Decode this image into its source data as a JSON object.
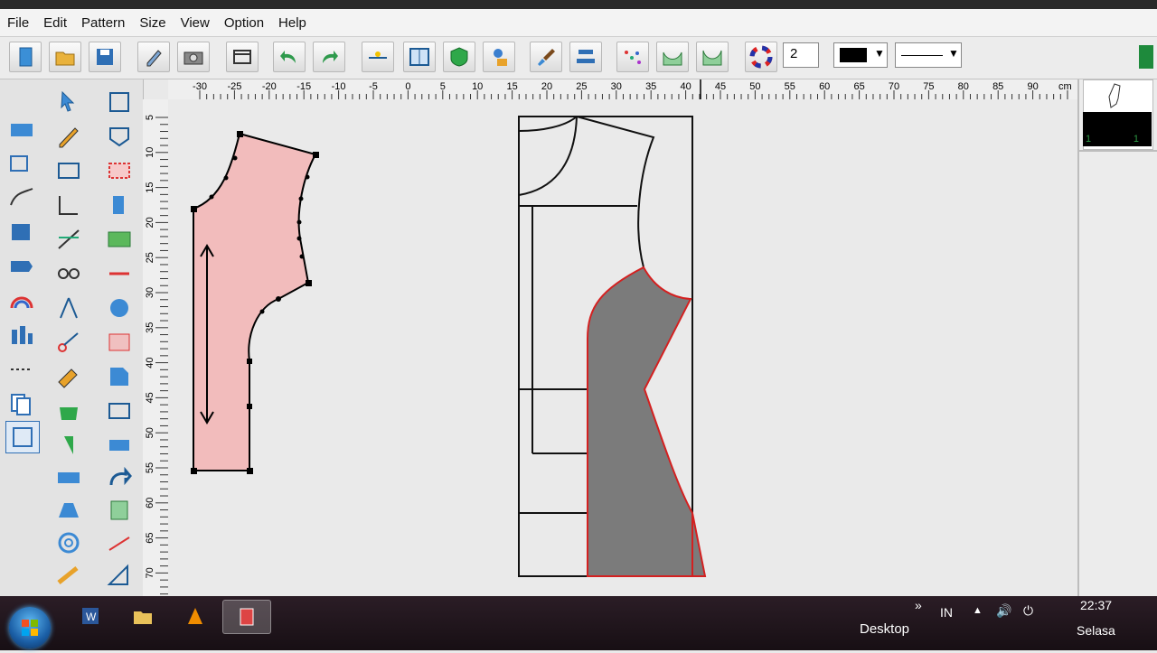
{
  "menu": [
    "File",
    "Edit",
    "Pattern",
    "Size",
    "View",
    "Option",
    "Help"
  ],
  "toolbar": {
    "buttons": [
      "new-file-icon",
      "open-folder-icon",
      "save-icon",
      "pencil-edit-icon",
      "camera-icon",
      "table-frame-icon",
      "undo-icon",
      "redo-icon",
      "grade-points-icon",
      "fit-window-icon",
      "shield-piece-icon",
      "user-lock-icon",
      "brush-icon",
      "align-icon",
      "scatter-plot-icon",
      "curve-tool-icon",
      "curve-fill-icon",
      "color-wheel-icon"
    ],
    "line_width": "2",
    "color_swatch": "#000000"
  },
  "ruler": {
    "h_labels": [
      "-30",
      "-25",
      "-20",
      "-15",
      "-10",
      "-5",
      "0",
      "5",
      "10",
      "15",
      "20",
      "25",
      "30",
      "35",
      "40",
      "45",
      "50",
      "55",
      "60",
      "65",
      "70",
      "75",
      "80",
      "85",
      "90"
    ],
    "h_unit": "cm",
    "v_labels": [
      "5",
      "10",
      "15",
      "20",
      "25",
      "30",
      "35",
      "40",
      "45",
      "50",
      "55",
      "60",
      "65",
      "70"
    ]
  },
  "right_panel": {
    "thumb_left_label": "1",
    "thumb_right_label": "1"
  },
  "taskbar": {
    "desktop_label": "Desktop",
    "language": "IN",
    "time": "22:37",
    "day": "Selasa"
  },
  "colors": {
    "pattern_fill": "#f2bcbc",
    "selected_fill": "#7b7b7b",
    "selected_outline": "#d42020",
    "accent": "#1a6fbf"
  }
}
